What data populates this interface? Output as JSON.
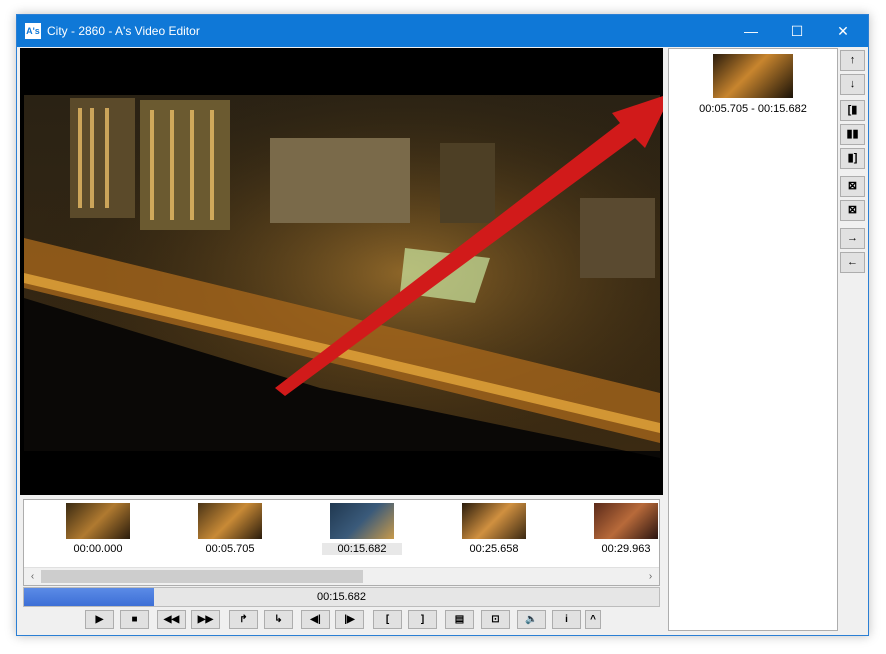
{
  "window": {
    "title": "City - 2860 - A's Video Editor",
    "icon_text": "A's",
    "minimize_icon": "—",
    "maximize_icon": "☐",
    "close_icon": "✕"
  },
  "timeline": {
    "thumbnails": [
      {
        "time": "00:00.000"
      },
      {
        "time": "00:05.705"
      },
      {
        "time": "00:15.682"
      },
      {
        "time": "00:25.658"
      },
      {
        "time": "00:29.963"
      }
    ]
  },
  "progress": {
    "current_time": "00:15.682",
    "fraction": 0.205
  },
  "clips": [
    {
      "range": "00:05.705 - 00:15.682"
    }
  ],
  "controls": [
    {
      "name": "play-button",
      "glyph": "▶"
    },
    {
      "name": "stop-button",
      "glyph": "■"
    },
    {
      "name": "rewind-button",
      "glyph": "◀◀"
    },
    {
      "name": "fast-forward-button",
      "glyph": "▶▶"
    },
    {
      "name": "jump-start-button",
      "glyph": "↱"
    },
    {
      "name": "jump-end-button",
      "glyph": "↳"
    },
    {
      "name": "prev-frame-button",
      "glyph": "◀|"
    },
    {
      "name": "next-frame-button",
      "glyph": "|▶"
    },
    {
      "name": "mark-in-button",
      "glyph": "["
    },
    {
      "name": "mark-out-button",
      "glyph": "]"
    },
    {
      "name": "filmstrip-button",
      "glyph": "▤"
    },
    {
      "name": "fit-frame-button",
      "glyph": "⊡"
    },
    {
      "name": "volume-button",
      "glyph": "🔈"
    },
    {
      "name": "info-button",
      "glyph": "i"
    },
    {
      "name": "collapse-button",
      "glyph": "^"
    }
  ],
  "side_buttons": [
    {
      "name": "move-up-button",
      "glyph": "↑"
    },
    {
      "name": "move-down-button",
      "glyph": "↓"
    },
    {
      "name": "split-left-button",
      "glyph": "[▮"
    },
    {
      "name": "split-button",
      "glyph": "▮▮"
    },
    {
      "name": "split-right-button",
      "glyph": "▮]"
    },
    {
      "name": "remove-clip-button",
      "glyph": "⊠"
    },
    {
      "name": "remove-all-button",
      "glyph": "⊠"
    },
    {
      "name": "export-button",
      "glyph": "→"
    },
    {
      "name": "import-button",
      "glyph": "←"
    }
  ],
  "colors": {
    "titlebar": "#0f78d7",
    "progress_fill": "#4a7de0",
    "arrow": "#d11a1a"
  }
}
